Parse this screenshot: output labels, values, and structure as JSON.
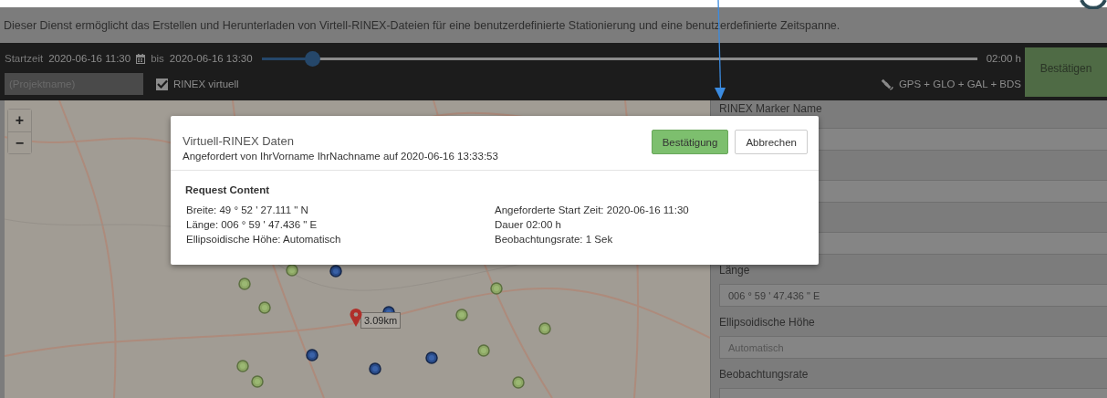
{
  "description": "Dieser Dienst ermöglicht das Erstellen und Herunterladen von Virtell-RINEX-Dateien für eine benutzerdefinierte Stationierung und eine benutzerdefinierte Zeitspanne.",
  "toolbar": {
    "start_label": "Startzeit",
    "start": "2020-06-16 11:30",
    "to_label": "bis",
    "end": "2020-06-16 13:30",
    "duration": {
      "level": 0.07
    },
    "duration_reading": "02:00 h",
    "project": {
      "placeholder": "(Projektname)"
    },
    "rinex_virtual": {
      "label": "RINEX virtuell",
      "checked": true
    },
    "constellations": "GPS + GLO + GAL + BDS",
    "confirm_button": "Bestätigen"
  },
  "map": {
    "zoom_in": "+",
    "zoom_out": "−",
    "distance_label": "3.09km"
  },
  "panel": {
    "fields": [
      {
        "label": "RINEX Marker Name"
      },
      {
        "label": "Länge",
        "value": "006 ° 59 ' 47.436 \" E"
      },
      {
        "label": "Ellipsoidische Höhe",
        "placeholder": "Automatisch"
      },
      {
        "label": "Beobachtungsrate"
      }
    ]
  },
  "modal": {
    "title": "Virtuell-RINEX Daten",
    "subtitle": "Angefordert von IhrVorname IhrNachname auf 2020-06-16 13:33:53",
    "buttons": [
      {
        "label": "Bestätigung",
        "kind": "primary"
      },
      {
        "label": "Abbrechen",
        "kind": "default"
      }
    ],
    "section_title": "Request Content",
    "left_lines": [
      "Breite: 49 ° 52 ' 27.111 \" N",
      "Länge: 006 ° 59 ' 47.436 \" E",
      "Ellipsoidische Höhe: Automatisch"
    ],
    "right_lines": [
      "Angeforderte Start Zeit: 2020-06-16 11:30",
      "Dauer 02:00 h",
      "Beobachtungsrate: 1 Sek"
    ]
  }
}
